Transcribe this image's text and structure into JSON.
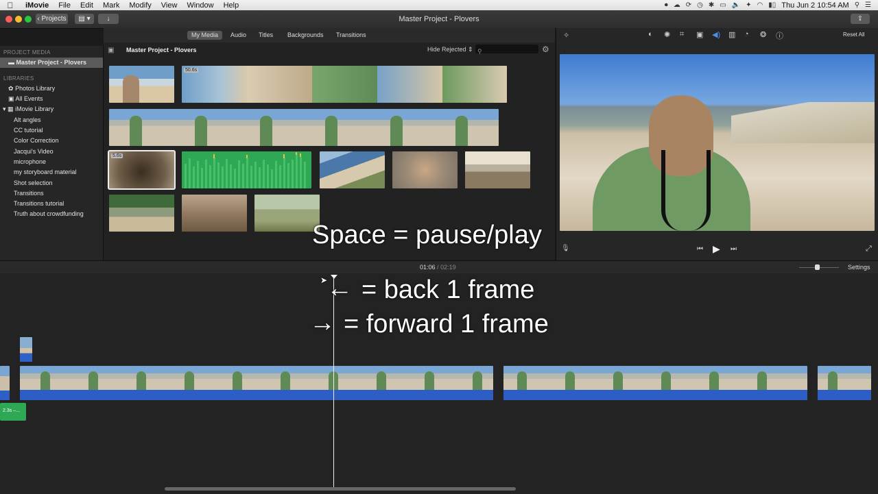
{
  "menubar": {
    "app": "iMovie",
    "items": [
      "File",
      "Edit",
      "Mark",
      "Modify",
      "View",
      "Window",
      "Help"
    ],
    "clock": "Thu Jun 2  10:54 AM"
  },
  "titlebar": {
    "projects_button": "Projects",
    "title": "Master Project - Plovers"
  },
  "tabs": [
    "My Media",
    "Audio",
    "Titles",
    "Backgrounds",
    "Transitions"
  ],
  "sidebar": {
    "project_media_heading": "PROJECT MEDIA",
    "project_item": "Master Project - Plovers",
    "libraries_heading": "LIBRARIES",
    "photos_library": "Photos Library",
    "all_events": "All Events",
    "imovie_library": "iMovie Library",
    "events": [
      "Alt angles",
      "CC tutorial",
      "Color Correction",
      "Jacqui's Video",
      "microphone",
      "my storyboard material",
      "Shot selection",
      "Transitions",
      "Transitions tutorial",
      "Truth about crowdfunding"
    ]
  },
  "browser": {
    "title": "Master Project - Plovers",
    "filter": "Hide Rejected",
    "clip_badges": {
      "c1": "50.6s",
      "c2": "5.6s"
    }
  },
  "viewer": {
    "reset_all": "Reset All"
  },
  "timeline": {
    "current_time": "01:06",
    "separator": "/",
    "total_time": "02:19",
    "settings": "Settings",
    "audio_clip_label": "2.3s –..."
  },
  "overlay": {
    "line1": "Space = pause/play",
    "line2": "= back 1 frame",
    "line3": "= forward 1 frame",
    "left_arrow": "←",
    "right_arrow": "→"
  },
  "colors": {
    "accent_blue": "#3a6fd0",
    "audio_green": "#2faa55",
    "selection_gray": "#5a5a5a"
  }
}
